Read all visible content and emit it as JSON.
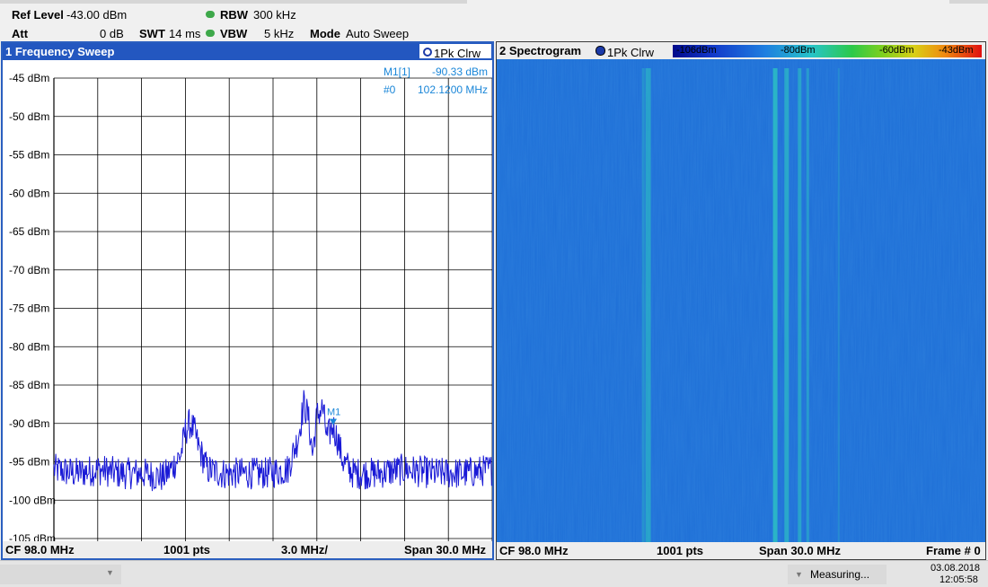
{
  "header": {
    "ref_level_label": "Ref Level",
    "ref_level_value": "-43.00 dBm",
    "att_label": "Att",
    "att_value": "0 dB",
    "swt_label": "SWT",
    "swt_value": "14 ms",
    "rbw_label": "RBW",
    "rbw_value": "300 kHz",
    "vbw_label": "VBW",
    "vbw_value": "5 kHz",
    "mode_label": "Mode",
    "mode_value": "Auto Sweep",
    "led_color": "#3ea84a"
  },
  "sweep": {
    "title": "1 Frequency Sweep",
    "trace_label": "1Pk Clrw",
    "marker_name": "M1[1]",
    "marker_level": "-90.33 dBm",
    "marker_index": "#0",
    "marker_freq": "102.1200 MHz",
    "marker_tag": "M1",
    "y_labels": [
      "-45 dBm",
      "-50 dBm",
      "-55 dBm",
      "-60 dBm",
      "-65 dBm",
      "-70 dBm",
      "-75 dBm",
      "-80 dBm",
      "-85 dBm",
      "-90 dBm",
      "-95 dBm",
      "-100 dBm",
      "-105 dBm"
    ],
    "footer": {
      "cf": "CF 98.0 MHz",
      "pts": "1001 pts",
      "div": "3.0 MHz/",
      "span": "Span 30.0 MHz"
    },
    "trace_color": "#1a1ad6",
    "marker_color": "#1a86d8"
  },
  "chart_data": {
    "type": "line",
    "title": "",
    "xlabel": "",
    "ylabel": "",
    "xlim": [
      83.0,
      113.0
    ],
    "ylim": [
      -105,
      -45
    ],
    "grid": true,
    "x_ticks_every_mhz": 3.0,
    "series": [
      {
        "x": [
          83.0,
          84.5,
          86.0,
          87.5,
          89.0,
          90.5,
          91.0,
          91.7,
          92.0,
          92.3,
          92.6,
          92.9,
          93.5,
          94.5,
          96.0,
          97.5,
          99.0,
          99.7,
          100.1,
          100.4,
          100.7,
          101.0,
          101.4,
          101.7,
          102.1,
          102.4,
          102.8,
          103.5,
          105.0,
          107.0,
          109.0,
          111.0,
          113.0
        ],
        "y": [
          -96,
          -96.5,
          -96,
          -96.5,
          -96.5,
          -97,
          -96,
          -94,
          -91,
          -90,
          -91,
          -93,
          -96,
          -96.5,
          -96.5,
          -96.5,
          -96,
          -92,
          -87.5,
          -89,
          -94,
          -89,
          -88,
          -92,
          -90.3,
          -92,
          -95,
          -96.5,
          -96.5,
          -96,
          -96.5,
          -96.5,
          -96
        ]
      }
    ],
    "marker": {
      "x": 102.12,
      "y": -90.33,
      "label": "M1"
    }
  },
  "spectrogram": {
    "title": "2 Spectrogram",
    "trace_label": "1Pk Clrw",
    "scale_labels": [
      "-106dBm",
      "-80dBm",
      "-60dBm",
      "-43dBm"
    ],
    "footer": {
      "cf": "CF 98.0 MHz",
      "pts": "1001 pts",
      "span": "Span 30.0 MHz",
      "frame": "Frame # 0"
    },
    "bg_color": "#1f6fd6",
    "line_color": "#2ec9c0"
  },
  "status": {
    "text": "Measuring...",
    "date": "03.08.2018",
    "time": "12:05:58",
    "dropdown_icon": "chevron-down-icon"
  }
}
